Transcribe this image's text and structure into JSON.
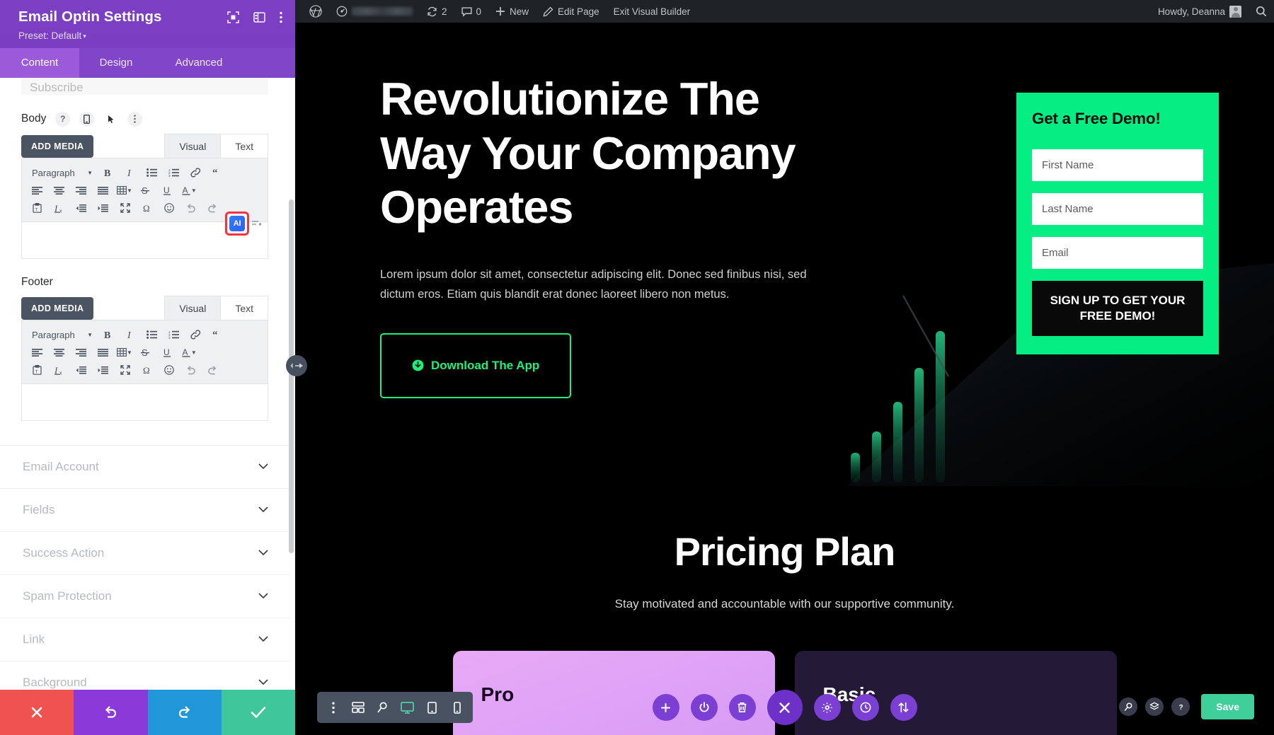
{
  "settings_panel": {
    "title": "Email Optin Settings",
    "preset": "Preset: Default",
    "header_icons": [
      {
        "name": "focus-icon"
      },
      {
        "name": "layout-toggle-icon"
      },
      {
        "name": "more-vertical-icon"
      }
    ],
    "tabs": [
      {
        "label": "Content",
        "active": true
      },
      {
        "label": "Design",
        "active": false
      },
      {
        "label": "Advanced",
        "active": false
      }
    ],
    "cut_off_field_value": "Subscribe",
    "body_field": {
      "label": "Body",
      "label_icons": [
        "help-icon",
        "mobile-icon",
        "cursor-icon",
        "more-vertical-icon"
      ],
      "add_media_label": "ADD MEDIA",
      "editor_tabs": [
        {
          "label": "Visual",
          "active": true
        },
        {
          "label": "Text",
          "active": false
        }
      ],
      "format_select": "Paragraph",
      "ai_button_label": "AI"
    },
    "footer_field": {
      "label": "Footer",
      "add_media_label": "ADD MEDIA",
      "editor_tabs": [
        {
          "label": "Visual",
          "active": true
        },
        {
          "label": "Text",
          "active": false
        }
      ],
      "format_select": "Paragraph"
    },
    "accordion": [
      {
        "label": "Email Account"
      },
      {
        "label": "Fields"
      },
      {
        "label": "Success Action"
      },
      {
        "label": "Spam Protection"
      },
      {
        "label": "Link"
      },
      {
        "label": "Background"
      }
    ],
    "footer_buttons": [
      {
        "name": "cancel-button",
        "icon": "close-icon",
        "color": "#f0534f"
      },
      {
        "name": "undo-button",
        "icon": "undo-icon",
        "color": "#8b39d9"
      },
      {
        "name": "redo-button",
        "icon": "redo-icon",
        "color": "#2196d9"
      },
      {
        "name": "save-button",
        "icon": "check-icon",
        "color": "#3fc69a"
      }
    ]
  },
  "admin_bar": {
    "wp_logo": "wordpress-logo-icon",
    "site_name_redacted": true,
    "updates_count": "2",
    "comments_count": "0",
    "new_label": "New",
    "edit_page_label": "Edit Page",
    "exit_builder_label": "Exit Visual Builder",
    "greeting": "Howdy, Deanna",
    "search": "search-icon"
  },
  "hero": {
    "heading": "Revolutionize The Way Your Company Operates",
    "paragraph": "Lorem ipsum dolor sit amet, consectetur adipiscing elit. Donec sed finibus nisi, sed dictum eros. Etiam quis blandit erat donec laoreet libero non metus.",
    "button_label": "Download The App",
    "button_icon": "download-circle-icon",
    "accent_color": "#1cf07a"
  },
  "optin": {
    "title": "Get a Free Demo!",
    "background_color": "#05ee84",
    "fields": [
      {
        "placeholder": "First Name",
        "name": "first-name-input"
      },
      {
        "placeholder": "Last Name",
        "name": "last-name-input"
      },
      {
        "placeholder": "Email",
        "name": "email-input"
      }
    ],
    "submit_label": "SIGN UP TO GET YOUR FREE DEMO!"
  },
  "pricing": {
    "heading": "Pricing Plan",
    "subheading": "Stay motivated and accountable with our supportive community.",
    "cards": [
      {
        "name": "Pro",
        "style": "pro"
      },
      {
        "name": "Basic",
        "style": "basic"
      }
    ]
  },
  "builder_toolbar": {
    "responsive_buttons": [
      {
        "name": "more-options-icon"
      },
      {
        "name": "wireframe-icon"
      },
      {
        "name": "zoom-out-icon"
      },
      {
        "name": "desktop-icon",
        "active": true
      },
      {
        "name": "tablet-icon"
      },
      {
        "name": "phone-icon"
      }
    ],
    "center_buttons": [
      {
        "name": "add-section-button",
        "icon": "plus-icon"
      },
      {
        "name": "toggle-power-button",
        "icon": "power-icon"
      },
      {
        "name": "delete-button",
        "icon": "trash-icon"
      },
      {
        "name": "close-builder-button",
        "icon": "close-icon"
      },
      {
        "name": "settings-button",
        "icon": "gear-icon"
      },
      {
        "name": "history-button",
        "icon": "clock-icon"
      },
      {
        "name": "portability-button",
        "icon": "updown-arrows-icon"
      }
    ],
    "right_buttons": [
      {
        "name": "search-button",
        "icon": "search-icon"
      },
      {
        "name": "layers-button",
        "icon": "layers-icon"
      },
      {
        "name": "help-button",
        "icon": "question-icon"
      }
    ],
    "save_label": "Save",
    "save_color": "#3ecf9b"
  }
}
